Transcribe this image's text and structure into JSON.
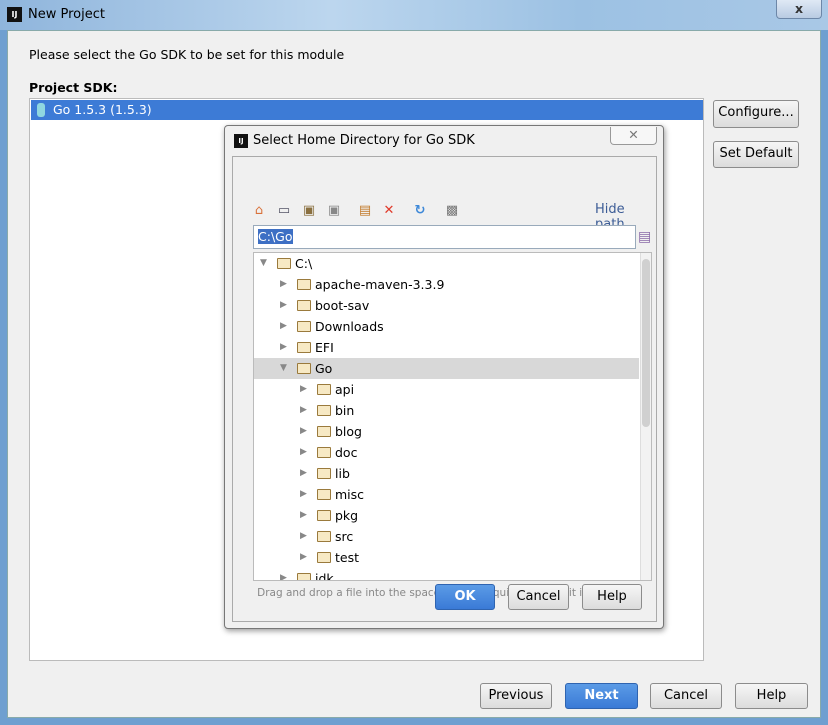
{
  "window": {
    "title": "New Project",
    "close": "x"
  },
  "prompt": "Please select the Go SDK to be set for this module",
  "sdk": {
    "label": "Project SDK:",
    "selected": "Go 1.5.3 (1.5.3)",
    "configure": "Configure...",
    "set_default": "Set Default"
  },
  "dialog": {
    "title": "Select Home Directory for Go SDK",
    "close": "✕",
    "hide_path": "Hide path",
    "path": "C:\\Go",
    "toolbar": [
      "home-icon",
      "desktop-icon",
      "project-icon",
      "module-icon",
      "new-folder-icon",
      "delete-icon",
      "refresh-icon",
      "show-hidden-icon"
    ],
    "tree": [
      {
        "label": "C:\\",
        "level": 0,
        "expanded": true
      },
      {
        "label": "apache-maven-3.3.9",
        "level": 1
      },
      {
        "label": "boot-sav",
        "level": 1
      },
      {
        "label": "Downloads",
        "level": 1
      },
      {
        "label": "EFI",
        "level": 1
      },
      {
        "label": "Go",
        "level": 1,
        "expanded": true,
        "selected": true
      },
      {
        "label": "api",
        "level": 2
      },
      {
        "label": "bin",
        "level": 2
      },
      {
        "label": "blog",
        "level": 2
      },
      {
        "label": "doc",
        "level": 2
      },
      {
        "label": "lib",
        "level": 2
      },
      {
        "label": "misc",
        "level": 2
      },
      {
        "label": "pkg",
        "level": 2
      },
      {
        "label": "src",
        "level": 2
      },
      {
        "label": "test",
        "level": 2
      },
      {
        "label": "idk",
        "level": 1
      }
    ],
    "hint": "Drag and drop a file into the space above to quickly locate it in the tree",
    "ok": "OK",
    "cancel": "Cancel",
    "help": "Help"
  },
  "footer": {
    "previous": "Previous",
    "next": "Next",
    "cancel": "Cancel",
    "help": "Help"
  }
}
